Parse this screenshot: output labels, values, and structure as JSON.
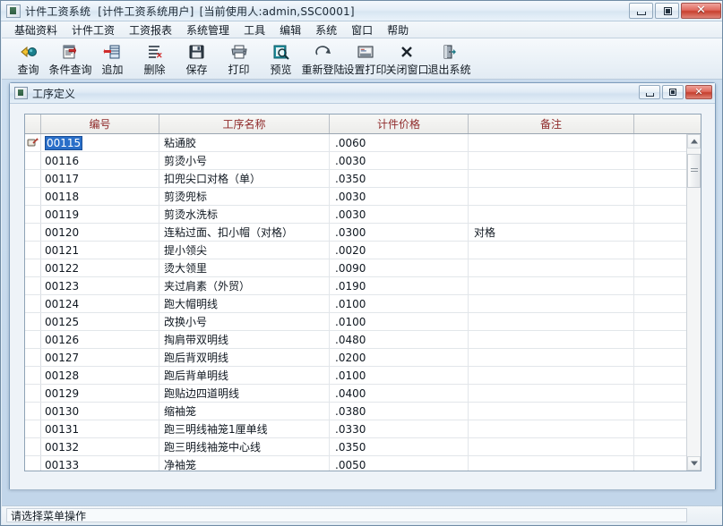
{
  "window": {
    "title": "计件工资系统",
    "subtitle1": "[计件工资系统用户]",
    "subtitle2": "[当前使用人:admin,SSC0001]",
    "app_icon": "app-icon",
    "minimize_label": "最小化",
    "maximize_label": "最大化",
    "close_label": "关闭"
  },
  "menubar": {
    "items": [
      {
        "label": "基础资料"
      },
      {
        "label": "计件工资"
      },
      {
        "label": "工资报表"
      },
      {
        "label": "系统管理"
      },
      {
        "label": "工具"
      },
      {
        "label": "编辑"
      },
      {
        "label": "系统"
      },
      {
        "label": "窗口"
      },
      {
        "label": "帮助"
      }
    ]
  },
  "toolbar": {
    "buttons": [
      {
        "label": "查询",
        "icon": "find-back-icon"
      },
      {
        "label": "条件查询",
        "icon": "filter-query-icon"
      },
      {
        "label": "追加",
        "icon": "append-row-icon"
      },
      {
        "label": "删除",
        "icon": "delete-row-icon"
      },
      {
        "label": "保存",
        "icon": "save-disk-icon"
      },
      {
        "label": "打印",
        "icon": "printer-icon"
      },
      {
        "label": "预览",
        "icon": "print-preview-icon"
      },
      {
        "label": "重新登陆",
        "icon": "relogin-arrow-icon"
      },
      {
        "label": "设置打印",
        "icon": "printer-setup-icon"
      },
      {
        "label": "关闭窗口",
        "icon": "close-x-icon"
      },
      {
        "label": "退出系统",
        "icon": "exit-door-icon"
      }
    ]
  },
  "child_window": {
    "title": "工序定义",
    "icon": "child-app-icon",
    "minimize_label": "最小化",
    "maximize_label": "还原",
    "close_label": "关闭"
  },
  "grid": {
    "columns": [
      {
        "key": "code",
        "label": "编号"
      },
      {
        "key": "name",
        "label": "工序名称"
      },
      {
        "key": "price",
        "label": "计件价格"
      },
      {
        "key": "memo",
        "label": "备注"
      }
    ],
    "current_row_index": 0,
    "rows": [
      {
        "code": "00115",
        "name": "粘通胶",
        "price": ".0060",
        "memo": ""
      },
      {
        "code": "00116",
        "name": "剪烫小号",
        "price": ".0030",
        "memo": ""
      },
      {
        "code": "00117",
        "name": "扣兜尖口对格（单）",
        "price": ".0350",
        "memo": ""
      },
      {
        "code": "00118",
        "name": "剪烫兜标",
        "price": ".0030",
        "memo": ""
      },
      {
        "code": "00119",
        "name": "剪烫水洗标",
        "price": ".0030",
        "memo": ""
      },
      {
        "code": "00120",
        "name": "连粘过面、扣小帽（对格）",
        "price": ".0300",
        "memo": "对格"
      },
      {
        "code": "00121",
        "name": "提小领尖",
        "price": ".0020",
        "memo": ""
      },
      {
        "code": "00122",
        "name": "烫大领里",
        "price": ".0090",
        "memo": ""
      },
      {
        "code": "00123",
        "name": "夹过肩素（外贸）",
        "price": ".0190",
        "memo": ""
      },
      {
        "code": "00124",
        "name": "跑大帽明线",
        "price": ".0100",
        "memo": ""
      },
      {
        "code": "00125",
        "name": "改换小号",
        "price": ".0100",
        "memo": ""
      },
      {
        "code": "00126",
        "name": "掏肩带双明线",
        "price": ".0480",
        "memo": ""
      },
      {
        "code": "00127",
        "name": "跑后背双明线",
        "price": ".0200",
        "memo": ""
      },
      {
        "code": "00128",
        "name": "跑后背单明线",
        "price": ".0100",
        "memo": ""
      },
      {
        "code": "00129",
        "name": "跑贴边四道明线",
        "price": ".0400",
        "memo": ""
      },
      {
        "code": "00130",
        "name": "缩袖笼",
        "price": ".0380",
        "memo": ""
      },
      {
        "code": "00131",
        "name": "跑三明线袖笼1厘单线",
        "price": ".0330",
        "memo": ""
      },
      {
        "code": "00132",
        "name": "跑三明线袖笼中心线",
        "price": ".0350",
        "memo": ""
      },
      {
        "code": "00133",
        "name": "净袖笼",
        "price": ".0050",
        "memo": ""
      }
    ],
    "scrollbar": {
      "up_arrow": "scroll-up-icon",
      "down_arrow": "scroll-down-icon",
      "thumb": "scroll-thumb"
    }
  },
  "statusbar": {
    "message": "请选择菜单操作"
  }
}
